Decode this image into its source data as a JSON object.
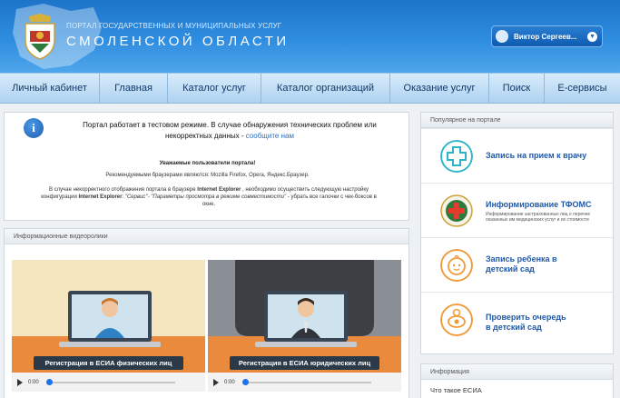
{
  "header": {
    "portal_subtitle": "ПОРТАЛ ГОСУДАРСТВЕННЫХ И МУНИЦИПАЛЬНЫХ УСЛУГ",
    "portal_title": "СМОЛЕНСКОЙ ОБЛАСТИ",
    "user_name": "Виктор Сергеев..."
  },
  "nav": {
    "items": [
      "Личный кабинет",
      "Главная",
      "Каталог услуг",
      "Каталог организаций",
      "Оказание услуг",
      "Поиск",
      "Е-сервисы"
    ]
  },
  "notice": {
    "main_text": "Портал работает в тестовом режиме. В случае обнаружения технических проблем или некорректных данных - ",
    "main_link": "сообщите нам",
    "users_heading": "Уважаемые пользователи портала!",
    "browsers": "Рекомендуемыми браузерами являются: Mozilla Firefox, Opera, Яндекс.Браузер.",
    "ie_part1": "В случае некорректного отображения портала в браузере ",
    "ie_browser": "Internet Explorer",
    "ie_part2": " , необходимо осуществить следующую настройку конфигурации ",
    "ie_browser2": "Internet Explorer",
    "ie_part3": ": ",
    "ie_settings": "\"Сервис\"- \"Параметры просмотра в режиме совместимости\"",
    "ie_part4": " - убрать все галочки с чек-боксов в окне."
  },
  "videos": {
    "heading": "Информационные видеоролики",
    "items": [
      {
        "caption": "Регистрация в ЕСИА физических лиц",
        "time": "0:00"
      },
      {
        "caption": "Регистрация в ЕСИА юридических лиц",
        "time": "0:00"
      }
    ]
  },
  "popular": {
    "heading": "Популярное на портале",
    "items": [
      {
        "label": "Запись на прием к врачу",
        "icon": "medical-cross-icon"
      },
      {
        "label": "Информирование ТФОМС",
        "sub": "Информирование застрахованных лиц о перечне оказанных им медицинских услуг и их стоимости",
        "icon": "tfoms-emblem-icon"
      },
      {
        "label_line1": "Запись ребенка в",
        "label_line2": "детский сад",
        "icon": "child-face-icon"
      },
      {
        "label_line1": "Проверить очередь",
        "label_line2": "в детский сад",
        "icon": "pacifier-icon"
      }
    ]
  },
  "information": {
    "heading": "Информация",
    "link": "Что такое ЕСИА"
  },
  "colors": {
    "header_blue": "#2f8de0",
    "link_blue": "#1e58a8",
    "icon_teal": "#2bb5c8",
    "icon_orange": "#f29a38"
  }
}
